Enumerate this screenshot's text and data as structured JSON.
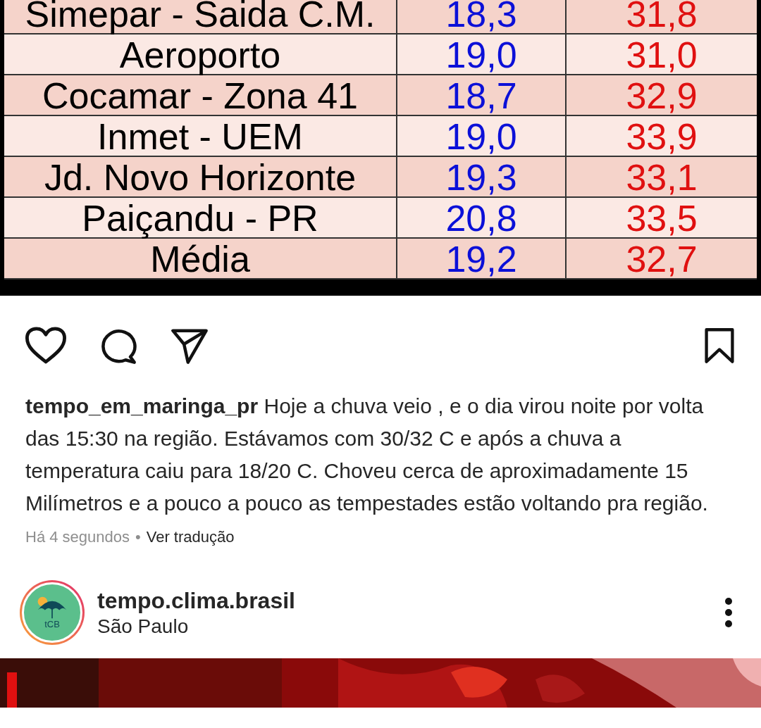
{
  "post_image": {
    "table": {
      "rows": [
        {
          "station": "Simepar - Saida C.M.",
          "min": "18,3",
          "max": "31,8"
        },
        {
          "station": "Aeroporto",
          "min": "19,0",
          "max": "31,0"
        },
        {
          "station": "Cocamar - Zona 41",
          "min": "18,7",
          "max": "32,9"
        },
        {
          "station": "Inmet - UEM",
          "min": "19,0",
          "max": "33,9"
        },
        {
          "station": "Jd. Novo Horizonte",
          "min": "19,3",
          "max": "33,1"
        },
        {
          "station": "Paiçandu - PR",
          "min": "20,8",
          "max": "33,5"
        },
        {
          "station": "Média",
          "min": "19,2",
          "max": "32,7"
        }
      ]
    }
  },
  "actions": {
    "liked": false,
    "saved": false
  },
  "caption": {
    "username": "tempo_em_maringa_pr",
    "text": "Hoje a chuva veio , e o dia virou noite por volta das 15:30 na região. Estávamos com 30/32 C e após a chuva a temperatura caiu para 18/20 C.  Choveu cerca de aproximadamente 15 Milímetros e a pouco a pouco as tempestades estão voltando pra região."
  },
  "meta": {
    "time": "Há 4 segundos",
    "separator": "•",
    "translate": "Ver tradução"
  },
  "next_post": {
    "avatar_text": "tCB",
    "username": "tempo.clima.brasil",
    "location": "São Paulo"
  }
}
